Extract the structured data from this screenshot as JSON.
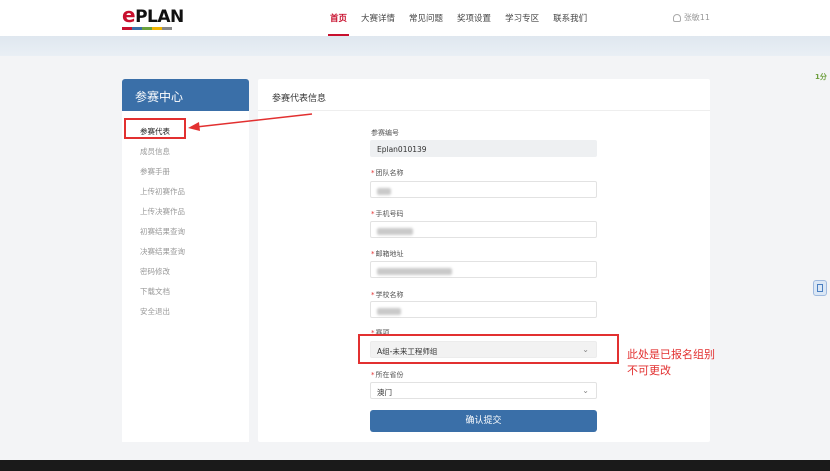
{
  "header": {
    "logo_text": "PLAN",
    "logo_e": "e",
    "nav": [
      "首页",
      "大赛详情",
      "常见问题",
      "奖项设置",
      "学习专区",
      "联系我们"
    ],
    "user": "张敏11"
  },
  "sidebar": {
    "title": "参赛中心",
    "items": [
      "参赛代表",
      "成员信息",
      "参赛手册",
      "上传初赛作品",
      "上传决赛作品",
      "初赛结果查询",
      "决赛结果查询",
      "密码修改",
      "下载文档",
      "安全退出"
    ]
  },
  "main": {
    "title": "参赛代表信息",
    "fields": {
      "id": {
        "label": "参赛编号",
        "value": "Eplan010139"
      },
      "team": {
        "label": "团队名称"
      },
      "phone": {
        "label": "手机号码"
      },
      "email": {
        "label": "邮箱地址"
      },
      "school": {
        "label": "学校名称"
      },
      "track": {
        "label": "赛项",
        "value": "A组-未来工程师组"
      },
      "province": {
        "label": "所在省份",
        "value": "澳门"
      }
    },
    "required_mark": "*",
    "submit_label": "确认提交"
  },
  "annotation": {
    "line1": "此处是已报名组别",
    "line2": "不可更改"
  },
  "float_left_text": "1分",
  "colors": {
    "brand": "#c8102e",
    "accent": "#3a6fa8",
    "annotation": "#e23030"
  }
}
